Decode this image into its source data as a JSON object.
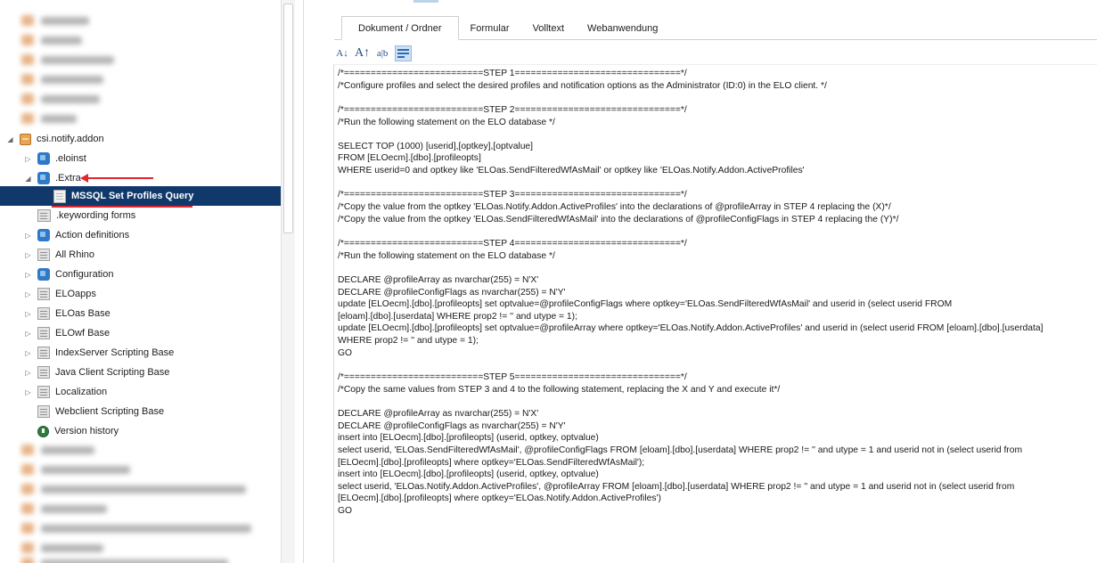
{
  "tree": {
    "items": [
      {
        "label": "csi.notify.addon",
        "icon": "package-icon",
        "toggle": "expanded"
      },
      {
        "label": ".eloinst",
        "icon": "cube-icon",
        "toggle": "collapsed"
      },
      {
        "label": ".Extra",
        "icon": "cube-icon",
        "toggle": "expanded"
      },
      {
        "label": "MSSQL Set Profiles Query",
        "icon": "document-icon",
        "toggle": "none",
        "selected": true
      },
      {
        "label": ".keywording forms",
        "icon": "keywording-form-icon",
        "toggle": "none"
      },
      {
        "label": "Action definitions",
        "icon": "cube-icon",
        "toggle": "collapsed"
      },
      {
        "label": "All Rhino",
        "icon": "cabinet-icon",
        "toggle": "collapsed"
      },
      {
        "label": "Configuration",
        "icon": "cube-icon",
        "toggle": "collapsed"
      },
      {
        "label": "ELOapps",
        "icon": "cabinet-icon",
        "toggle": "collapsed"
      },
      {
        "label": "ELOas Base",
        "icon": "cabinet-icon",
        "toggle": "collapsed"
      },
      {
        "label": "ELOwf Base",
        "icon": "cabinet-icon",
        "toggle": "collapsed"
      },
      {
        "label": "IndexServer Scripting Base",
        "icon": "cabinet-icon",
        "toggle": "collapsed"
      },
      {
        "label": "Java Client Scripting Base",
        "icon": "cabinet-icon",
        "toggle": "collapsed"
      },
      {
        "label": "Localization",
        "icon": "cabinet-icon",
        "toggle": "collapsed"
      },
      {
        "label": "Webclient Scripting Base",
        "icon": "cabinet-icon",
        "toggle": "none"
      },
      {
        "label": "Version history",
        "icon": "version-history-icon",
        "toggle": "none"
      }
    ],
    "toggle_glyphs": {
      "expanded": "◢",
      "collapsed": "▷",
      "none": ""
    }
  },
  "tabs": [
    "Dokument / Ordner",
    "Formular",
    "Volltext",
    "Webanwendung"
  ],
  "toolbar": [
    {
      "label": "A↓",
      "name": "font-smaller-button"
    },
    {
      "label": "A↑",
      "name": "font-larger-button"
    },
    {
      "label": "a|b",
      "name": "show-whitespace-button"
    },
    {
      "label": "",
      "name": "word-wrap-button"
    }
  ],
  "editor": {
    "lines": [
      "/*==========================STEP 1===============================*/",
      "/*Configure profiles and select the desired profiles and notification options as the Administrator (ID:0) in the ELO client. */",
      "",
      "/*==========================STEP 2===============================*/",
      "/*Run the following statement on the ELO database */",
      "",
      "SELECT TOP (1000) [userid],[optkey],[optvalue]",
      "FROM [ELOecm].[dbo].[profileopts]",
      "WHERE userid=0 and optkey like 'ELOas.SendFilteredWfAsMail' or optkey like 'ELOas.Notify.Addon.ActiveProfiles'",
      "",
      "/*==========================STEP 3===============================*/",
      "/*Copy the value from the optkey 'ELOas.Notify.Addon.ActiveProfiles' into the declarations of @profileArray in STEP 4 replacing the (X)*/",
      "/*Copy the value from the optkey 'ELOas.SendFilteredWfAsMail' into the declarations of @profileConfigFlags in STEP 4 replacing the (Y)*/",
      "",
      "/*==========================STEP 4===============================*/",
      "/*Run the following statement on the ELO database */",
      "",
      "DECLARE @profileArray as nvarchar(255) = N'X'",
      "DECLARE @profileConfigFlags as nvarchar(255) = N'Y'",
      "update [ELOecm].[dbo].[profileopts] set optvalue=@profileConfigFlags where optkey='ELOas.SendFilteredWfAsMail' and userid in (select userid FROM",
      "[eloam].[dbo].[userdata] WHERE prop2 != '' and utype = 1);",
      "update [ELOecm].[dbo].[profileopts] set optvalue=@profileArray where optkey='ELOas.Notify.Addon.ActiveProfiles' and userid in (select userid FROM [eloam].[dbo].[userdata]",
      "WHERE prop2 != '' and utype = 1);",
      "GO",
      "",
      "/*==========================STEP 5===============================*/",
      "/*Copy the same values from STEP 3 and 4 to the following statement, replacing the X and Y and execute it*/",
      "",
      "DECLARE @profileArray as nvarchar(255) = N'X'",
      "DECLARE @profileConfigFlags as nvarchar(255) = N'Y'",
      "insert into [ELOecm].[dbo].[profileopts] (userid, optkey, optvalue)",
      "select userid, 'ELOas.SendFilteredWfAsMail', @profileConfigFlags FROM [eloam].[dbo].[userdata] WHERE prop2 != '' and utype = 1 and userid not in (select userid from",
      "[ELOecm].[dbo].[profileopts] where optkey='ELOas.SendFilteredWfAsMail');",
      "insert into [ELOecm].[dbo].[profileopts] (userid, optkey, optvalue)",
      "select userid, 'ELOas.Notify.Addon.ActiveProfiles', @profileArray FROM [eloam].[dbo].[userdata] WHERE prop2 != '' and utype = 1 and userid not in (select userid from",
      "[ELOecm].[dbo].[profileopts] where optkey='ELOas.Notify.Addon.ActiveProfiles')",
      "GO"
    ]
  },
  "colors": {
    "selection": "#10386b",
    "annotation": "#e0262e",
    "accent": "#2b6cb5"
  }
}
